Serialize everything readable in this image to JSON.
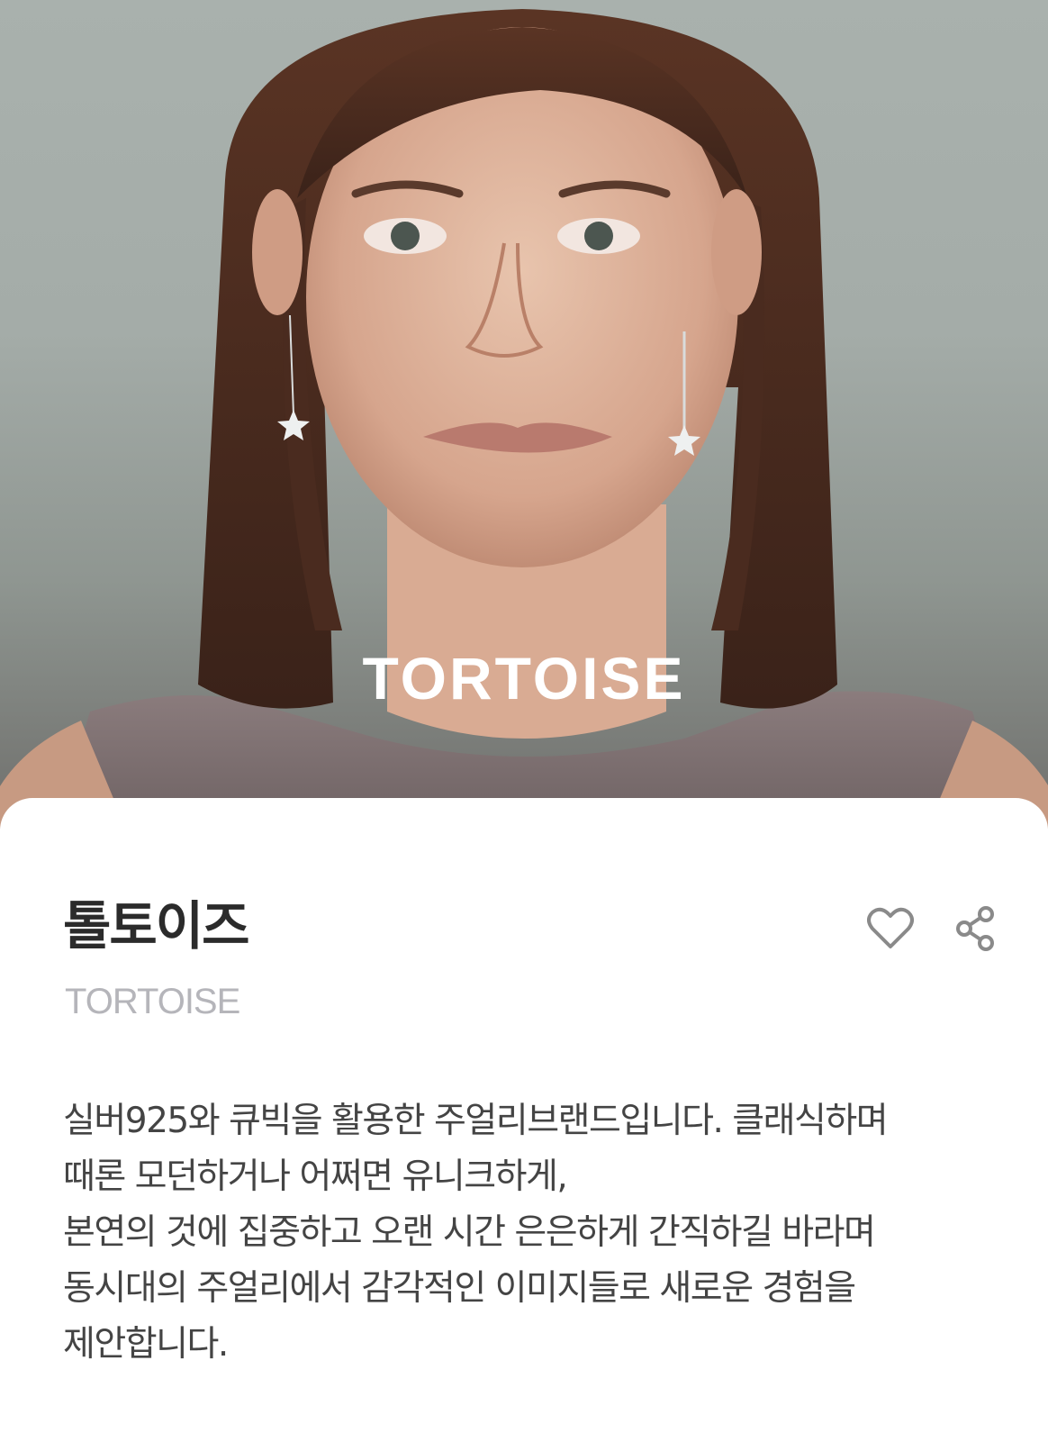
{
  "hero": {
    "logo_text": "TORTOISE"
  },
  "brand": {
    "name_ko": "톨토이즈",
    "name_en": "TORTOISE"
  },
  "actions": {
    "like_icon": "heart-outline-icon",
    "share_icon": "share-nodes-icon"
  },
  "description": {
    "lines": [
      "실버925와 큐빅을 활용한 주얼리브랜드입니다. 클래식하며",
      "때론 모던하거나 어쩌면 유니크하게,",
      "본연의 것에 집중하고 오랜 시간 은은하게 간직하길 바라며",
      "동시대의 주얼리에서 감각적인 이미지들로 새로운 경험을",
      "제안합니다."
    ]
  },
  "colors": {
    "title": "#2b2b2b",
    "subtitle": "#b5b5ba",
    "body": "#444444",
    "icon": "#8a8a8a"
  }
}
